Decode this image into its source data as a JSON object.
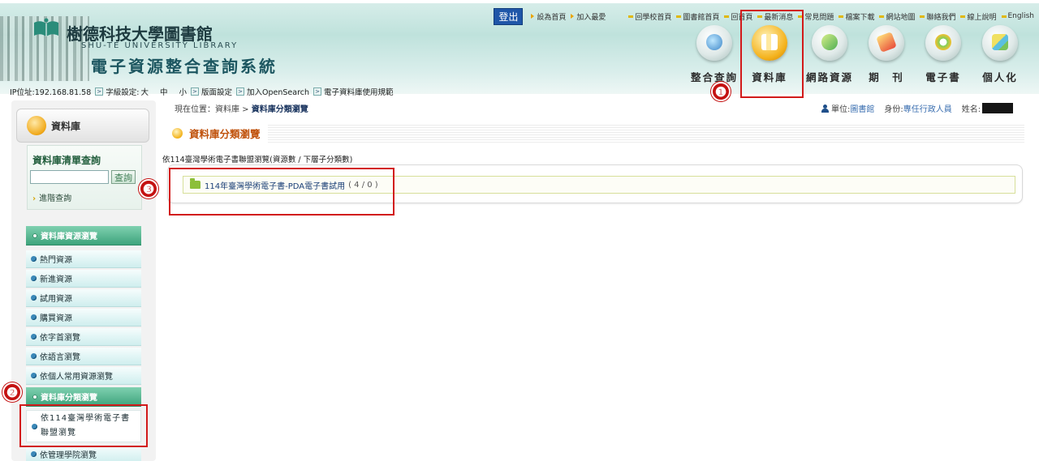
{
  "header": {
    "library_name": "樹德科技大學圖書館",
    "library_name_en": "SHU-TE UNIVERSITY LIBRARY",
    "system_title": "電子資源整合查詢系統",
    "logout_label": "登出",
    "top_links": [
      "設為首頁",
      "加入最愛"
    ],
    "util_links": [
      "回學校首頁",
      "圖書館首頁",
      "回首頁",
      "最新消息",
      "常見問題",
      "檔案下載",
      "網站地圖",
      "聯絡我們",
      "線上說明",
      "English"
    ],
    "nav_items": [
      {
        "label": "整合查詢",
        "icon": "search-globe-icon"
      },
      {
        "label": "資料庫",
        "icon": "database-icon"
      },
      {
        "label": "網路資源",
        "icon": "network-resource-icon"
      },
      {
        "label": "期　刊",
        "icon": "journal-icon"
      },
      {
        "label": "電子書",
        "icon": "ebook-icon"
      },
      {
        "label": "個人化",
        "icon": "personalize-icon"
      }
    ],
    "ip_text": "IP位址:192.168.81.58",
    "font_setting_label": "字級設定:",
    "font_size_large": "大",
    "font_size_medium": "中",
    "font_size_small": "小",
    "layout_setting_label": "版面設定",
    "opensearch_label": "加入OpenSearch",
    "rules_label": "電子資料庫使用規範"
  },
  "sidebar": {
    "section_title": "資料庫",
    "query_title": "資料庫清單查詢",
    "query_placeholder": "",
    "query_button": "查詢",
    "advanced_link": "進階查詢",
    "browse_header": "資料庫資源瀏覽",
    "browse_items": [
      "熱門資源",
      "新進資源",
      "試用資源",
      "購買資源",
      "依字首瀏覽",
      "依語言瀏覽",
      "依個人常用資源瀏覽"
    ],
    "category_header": "資料庫分類瀏覽",
    "category_items": [
      "依114臺灣學術電子書聯盟瀏覽",
      "依管理學院瀏覽"
    ]
  },
  "main": {
    "breadcrumb_prefix": "現在位置：資料庫 >",
    "breadcrumb_current": "資料庫分類瀏覽",
    "unit_label": "單位:",
    "unit_value": "圖書館",
    "role_label": "身份:",
    "role_value": "專任行政人員",
    "name_label": "姓名:",
    "page_title": "資料庫分類瀏覽",
    "section_label": "依114臺灣學術電子書聯盟瀏覽(資源數 / 下層子分類數)",
    "categories": [
      {
        "name": "114年臺灣學術電子書-PDA電子書試用",
        "count": "( 4 / 0 )"
      }
    ]
  },
  "annotations": {
    "badge_1": "❶",
    "badge_2": "❷",
    "badge_3": "❸"
  },
  "colors": {
    "highlight": "#d21a1a",
    "menu_header": "#3ea47c",
    "page_title": "#c0520c"
  }
}
